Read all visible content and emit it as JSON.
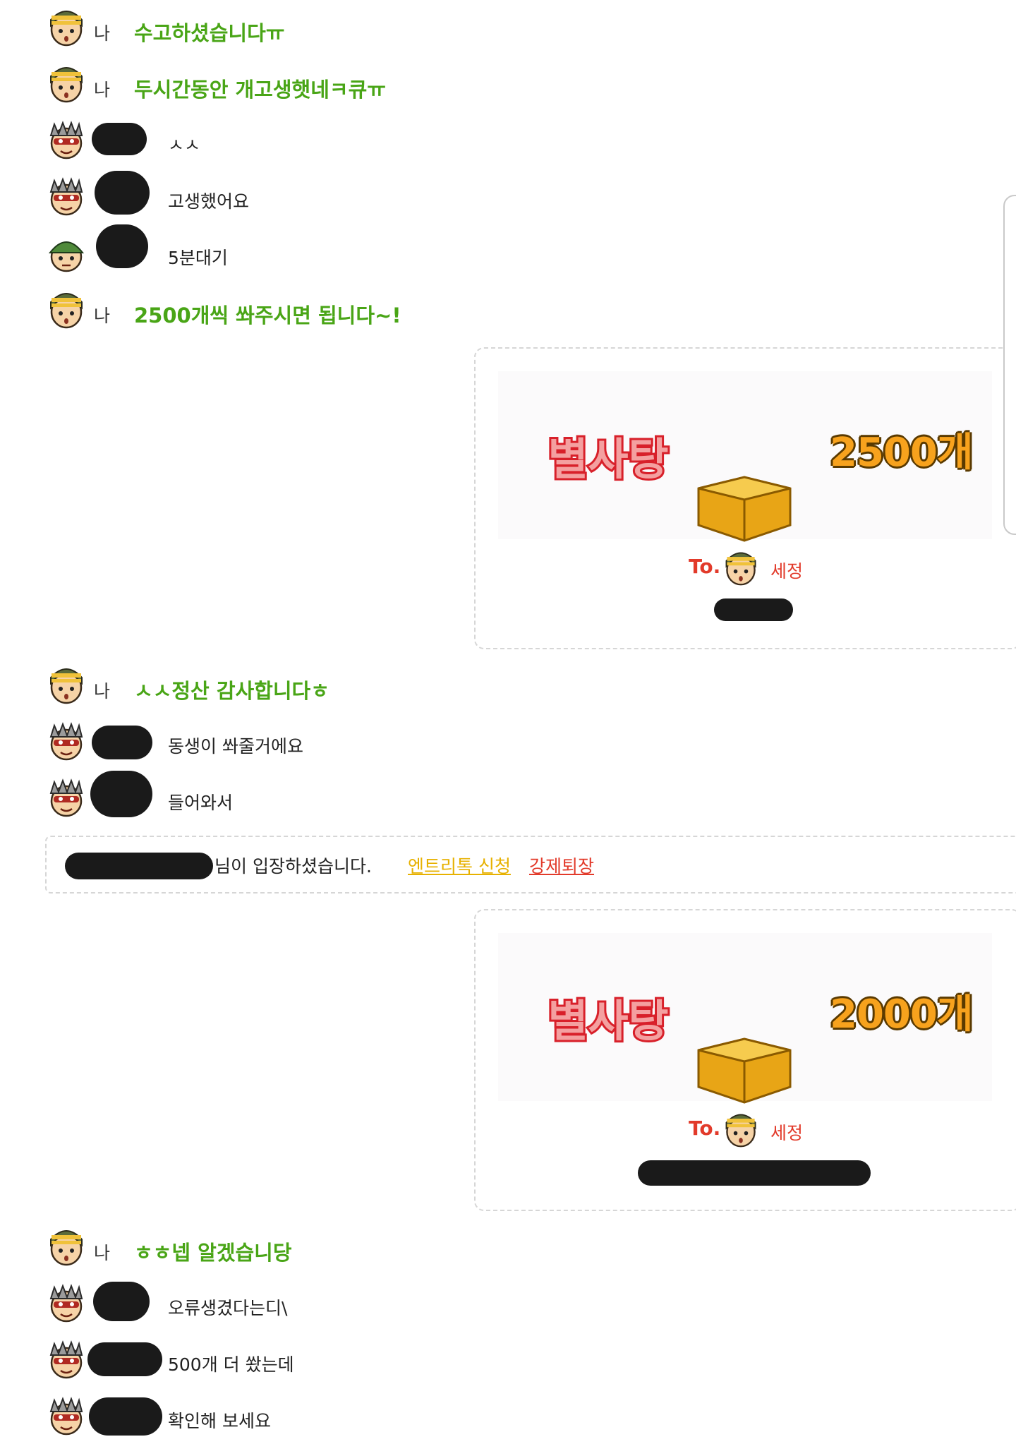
{
  "chat": {
    "me_label": "나",
    "messages": [
      {
        "text": "수고하셨습니다ㅠ"
      },
      {
        "text": "두시간동안 개고생햇네ㅋ큐ㅠ"
      },
      {
        "text": "ㅅㅅ"
      },
      {
        "text": "고생했어요"
      },
      {
        "text": "5분대기"
      },
      {
        "text": "2500개씩 쏴주시면 됩니다~!"
      },
      {
        "text": "ㅅㅅ정산 감사합니다ㅎ"
      },
      {
        "text": "동생이 쏴줄거에요"
      },
      {
        "text": "들어와서"
      },
      {
        "text": "ㅎㅎ넵 알겠습니당"
      },
      {
        "text": "오류생겼다는디\\"
      },
      {
        "text": "500개 더 쐈는데"
      },
      {
        "text": "확인해 보세요"
      }
    ],
    "gifts": [
      {
        "logo": "별사탕",
        "amount": "2500개",
        "to_label": "To.",
        "recipient": "세정"
      },
      {
        "logo": "별사탕",
        "amount": "2000개",
        "to_label": "To.",
        "recipient": "세정"
      }
    ],
    "system": {
      "text": "님이 입장하셨습니다.",
      "link_entry": "엔트리톡 신청",
      "link_kick": "강제퇴장"
    }
  },
  "colors": {
    "my_message": "#49a516",
    "gift_red": "#e23a2a",
    "gift_amount": "#f7a21d",
    "entry_link": "#e7b100"
  }
}
